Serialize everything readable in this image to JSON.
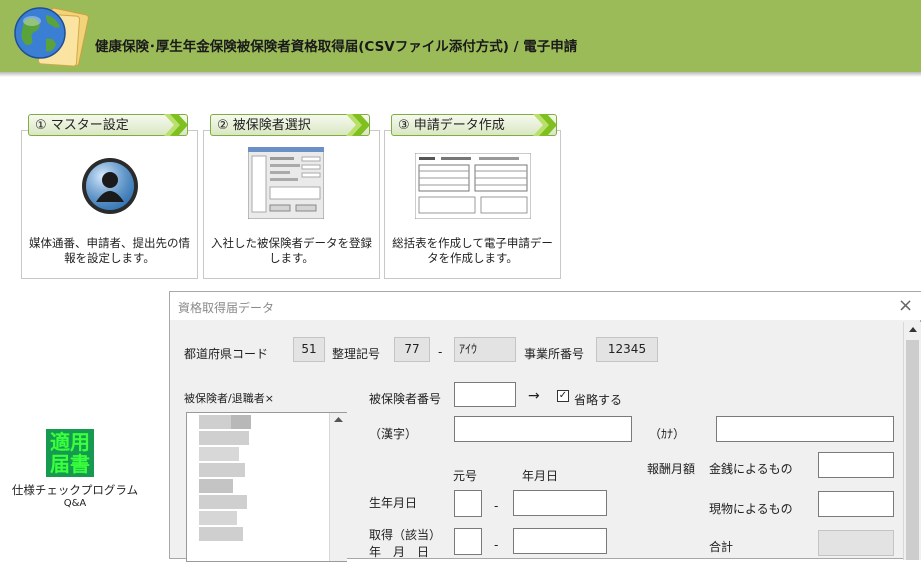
{
  "header": {
    "title": "健康保険･厚生年金保険被保険者資格取得届(CSVファイル添付方式)  /  電子申請",
    "logo_icon": "globe-folder-icon"
  },
  "steps": [
    {
      "label": "① マスター設定",
      "desc": "媒体通番、申請者、提出先の情報を設定します。",
      "icon": "user-avatar-icon"
    },
    {
      "label": "② 被保険者選択",
      "desc": "入社した被保険者データを登録します。",
      "icon": "form-screenshot-icon"
    },
    {
      "label": "③ 申請データ作成",
      "desc": "総括表を作成して電子申請データを作成します。",
      "icon": "document-preview-icon"
    }
  ],
  "sidebar_links": {
    "tekiyou_line1": "適用",
    "tekiyou_line2": "届書",
    "check_program": "仕様チェックプログラム",
    "qa": "Q&A"
  },
  "dialog": {
    "title": "資格取得届データ",
    "close_label": "×",
    "pref_code_label": "都道府県コード",
    "pref_code_value": "51",
    "seiri_label": "整理記号",
    "seiri_value1": "77",
    "dash": "-",
    "seiri_value2": "ｱｲｳ",
    "office_no_label": "事業所番号",
    "office_no_value": "12345",
    "list_header": "被保険者/退職者×",
    "insured_no_label": "被保険者番号",
    "arrow": "→",
    "check_mark": "✓",
    "omit_label": "省略する",
    "kanji_label": "（漢字）",
    "kana_label": "（ｶﾅ）",
    "gengo_label": "元号",
    "ymd_label": "年月日",
    "birth_label": "生年月日",
    "acq_label1": "取得（該当）",
    "acq_label2": "年　月　日",
    "reward_label": "報酬月額",
    "cash_label": "金銭によるもの",
    "kind_label": "現物によるもの",
    "total_label": "合計"
  },
  "colors": {
    "header_bg": "#9bbb59",
    "step_arrow": "#7fbf1f"
  }
}
